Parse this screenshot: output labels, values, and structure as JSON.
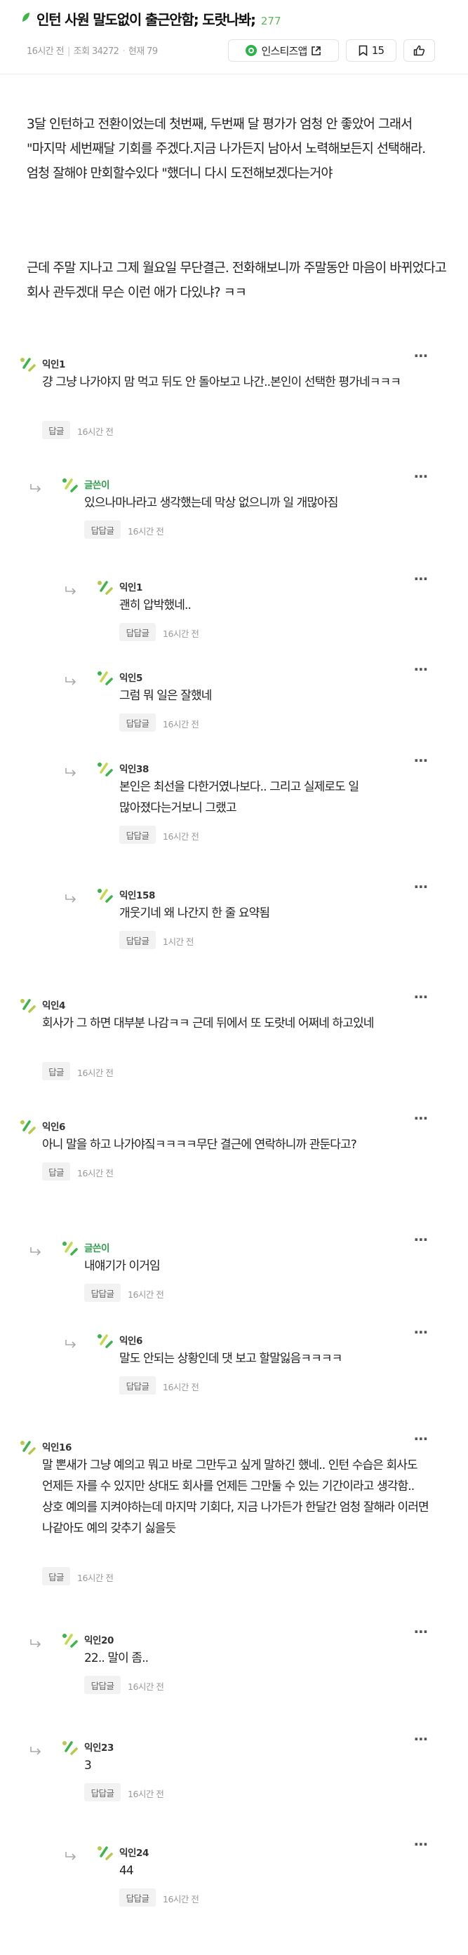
{
  "header": {
    "title": "인턴 사원 말도없이 출근안함; 도랏나봐;",
    "comment_count": "277",
    "time": "16시간 전",
    "views": "조회 34272",
    "hyunjae": "현재 79",
    "instiz_app_label": "인스티즈앱",
    "bookmark_count": "15",
    "colors": {
      "accent": "#2db34a"
    }
  },
  "post": {
    "paragraph1": "3달 인턴하고 전환이었는데 첫번째, 두번째 달 평가가 엄청 안 좋았어 그래서 \"마지막 세번째달 기회를 주겠다.지금 나가든지 남아서 노력해보든지 선택해라.엄청 잘해야 만회할수있다 \"했더니 다시 도전해보겠다는거야",
    "paragraph2": "근데 주말 지나고 그제 월요일 무단결근. 전화해보니까 주말동안 마음이 바뀌었다고 회사 관두겠대 무슨 이런 애가 다있냐? ㅋㅋ"
  },
  "comments": [
    {
      "author": "익인1",
      "text": "걍 그냥 나가야지 맘 먹고 뒤도 안 돌아보고 나간..본인이 선택한 평가네ㅋㅋㅋ",
      "reply_label": "답글",
      "time": "16시간 전"
    },
    {
      "author": "글쓴이",
      "text": "있으나마나라고 생각했는데 막상 없으니까 일 개많아짐",
      "reply_label": "답답글",
      "time": "16시간 전"
    },
    {
      "author": "익인1",
      "text": "괜히 압박했네..",
      "reply_label": "답답글",
      "time": "16시간 전"
    },
    {
      "author": "익인5",
      "text": "그럼 뭐 일은 잘했네",
      "reply_label": "답답글",
      "time": "16시간 전"
    },
    {
      "author": "익인38",
      "text": "본인은 최선을 다한거였나보다.. 그리고 실제로도 일 많아졌다는거보니 그랬고",
      "reply_label": "답답글",
      "time": "16시간 전"
    },
    {
      "author": "익인158",
      "text": "개웃기네 왜 나간지 한 줄 요약됨",
      "reply_label": "답답글",
      "time": "1시간 전"
    },
    {
      "author": "익인4",
      "text": "회사가 그 하면 대부분 나감ㅋㅋ 근데 뒤에서 또 도랏네 어쩌네 하고있네",
      "reply_label": "답글",
      "time": "16시간 전"
    },
    {
      "author": "익인6",
      "text": "아니 말을 하고 나가야짘ㅋㅋㅋㅋ무단 결근에 연락하니까 관둔다고?",
      "reply_label": "답글",
      "time": "16시간 전"
    },
    {
      "author": "글쓴이",
      "text": "내얘기가 이거임",
      "reply_label": "답답글",
      "time": "16시간 전"
    },
    {
      "author": "익인6",
      "text": "말도 안되는 상황인데 댓 보고 할말잃음ㅋㅋㅋㅋ",
      "reply_label": "답답글",
      "time": "16시간 전"
    },
    {
      "author": "익인16",
      "text": "말 뽄새가 그냥 예의고 뭐고 바로 그만두고 싶게 말하긴 했네.. 인턴 수습은 회사도 언제든 자를 수 있지만 상대도 회사를 언제든 그만둘 수 있는 기간이라고 생각함.. 상호 예의를 지켜야하는데 마지막 기회다, 지금 나가든가 한달간 엄청 잘해라 이러면 나같아도 예의 갖추기 싫을듯",
      "reply_label": "답글",
      "time": "16시간 전"
    },
    {
      "author": "익인20",
      "text": "22.. 말이 좀..",
      "reply_label": "답답글",
      "time": "16시간 전"
    },
    {
      "author": "익인23",
      "text": "3",
      "reply_label": "답답글",
      "time": "16시간 전"
    },
    {
      "author": "익인24",
      "text": "44",
      "reply_label": "답답글",
      "time": "16시간 전"
    }
  ]
}
